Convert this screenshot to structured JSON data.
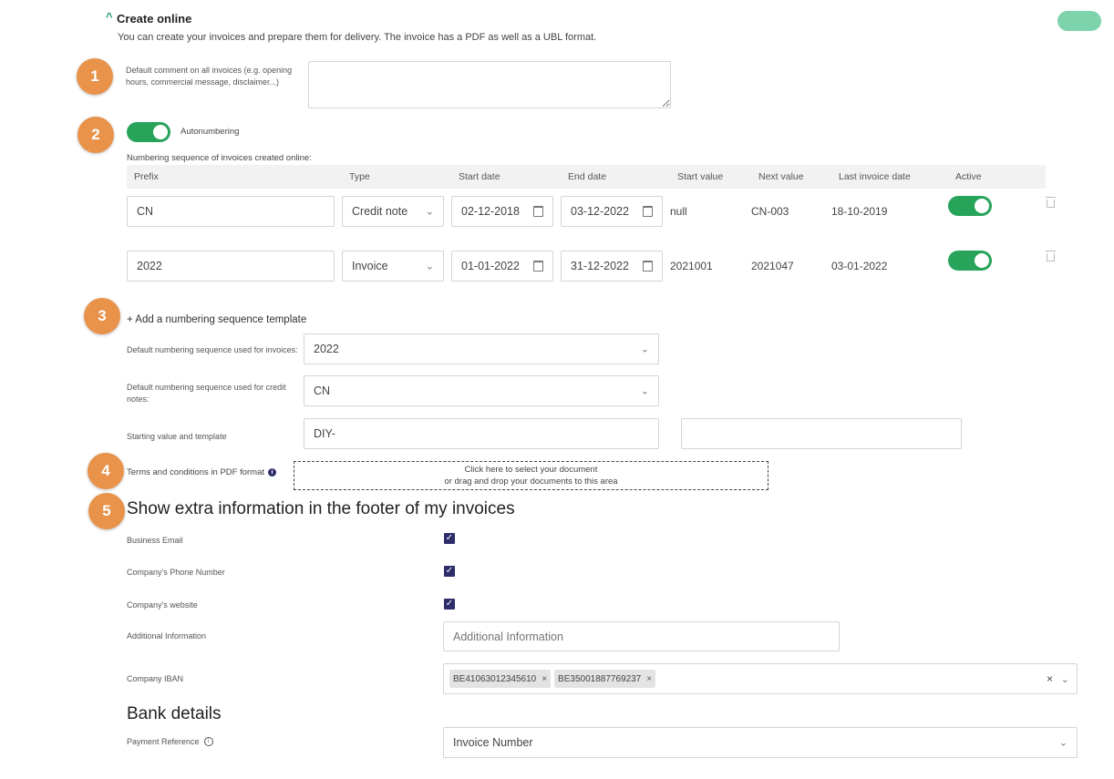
{
  "section": {
    "toggle_arrow": "^",
    "title": "Create online",
    "description": "You can create your invoices and prepare them for delivery. The invoice has a PDF as well as a UBL format."
  },
  "steps": [
    "1",
    "2",
    "3",
    "4",
    "5"
  ],
  "default_comment": {
    "label": "Default comment on all invoices (e.g. opening hours, commercial message, disclaimer...)",
    "value": ""
  },
  "autonumbering": {
    "label": "Autonumbering",
    "enabled": true
  },
  "numbering": {
    "heading": "Numbering sequence of invoices created online:",
    "columns": [
      "Prefix",
      "Type",
      "Start date",
      "End date",
      "Start value",
      "Next value",
      "Last invoice date",
      "Active"
    ],
    "rows": [
      {
        "prefix": "CN",
        "type": "Credit note",
        "start_date": "02-12-2018",
        "end_date": "03-12-2022",
        "start_value": "null",
        "next_value": "CN-003",
        "last_invoice_date": "18-10-2019",
        "active": true
      },
      {
        "prefix": "2022",
        "type": "Invoice",
        "start_date": "01-01-2022",
        "end_date": "31-12-2022",
        "start_value": "2021001",
        "next_value": "2021047",
        "last_invoice_date": "03-01-2022",
        "active": true
      }
    ],
    "add_template": "+ Add a numbering sequence template"
  },
  "defaults": {
    "invoices_label": "Default numbering sequence used for invoices:",
    "invoices_value": "2022",
    "credit_label": "Default numbering sequence used for credit notes:",
    "credit_value": "CN",
    "starting_label": "Starting value and template",
    "starting_value": "DIY-",
    "starting_value2": ""
  },
  "terms": {
    "label": "Terms and conditions in PDF format",
    "info_icon": "info-icon",
    "drop_line1": "Click here to select your document",
    "drop_line2": "or drag and drop your documents to this area"
  },
  "footer": {
    "title": "Show extra information in the footer of my invoices",
    "business_email": {
      "label": "Business Email",
      "checked": true
    },
    "phone": {
      "label": "Company's Phone Number",
      "checked": true
    },
    "website": {
      "label": "Company's website",
      "checked": true
    },
    "additional_label": "Additional Information",
    "additional_placeholder": "Additional Information",
    "iban_label": "Company IBAN",
    "ibans": [
      "BE41063012345610",
      "BE35001887769237"
    ],
    "tag_remove": "×",
    "clear": "×"
  },
  "bank": {
    "title": "Bank details",
    "payment_ref_label": "Payment Reference",
    "payment_ref_value": "Invoice Number"
  },
  "colors": {
    "accent_green": "#27a35a",
    "badge_orange": "#e8924a",
    "checkbox": "#2d2d6b",
    "pill": "#7dd3ab"
  }
}
